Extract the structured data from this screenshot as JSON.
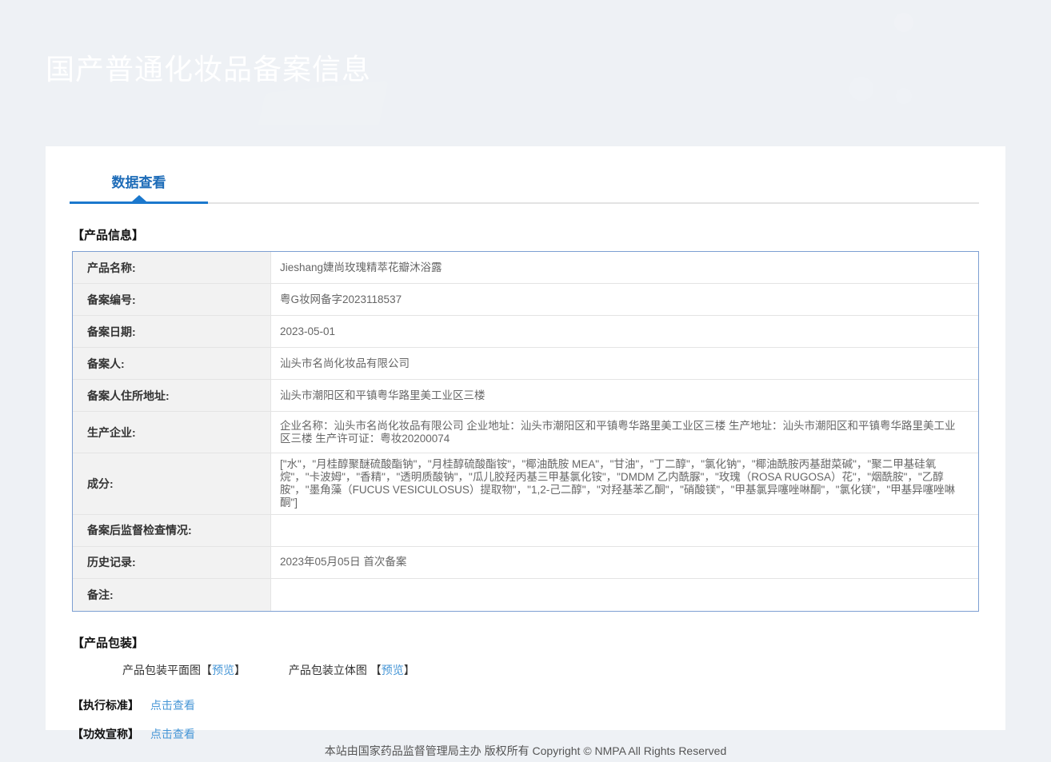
{
  "header": {
    "title": "国产普通化妆品备案信息"
  },
  "tabs": {
    "active": "数据查看"
  },
  "product_info": {
    "section_title": "【产品信息】",
    "rows": [
      {
        "label": "产品名称:",
        "value": "Jieshang婕尚玫瑰精萃花瓣沐浴露"
      },
      {
        "label": "备案编号:",
        "value": "粤G妆网备字2023118537"
      },
      {
        "label": "备案日期:",
        "value": "2023-05-01"
      },
      {
        "label": "备案人:",
        "value": "汕头市名尚化妆品有限公司"
      },
      {
        "label": "备案人住所地址:",
        "value": "汕头市潮阳区和平镇粤华路里美工业区三楼"
      },
      {
        "label": "生产企业:",
        "value": "企业名称：汕头市名尚化妆品有限公司 企业地址：汕头市潮阳区和平镇粤华路里美工业区三楼 生产地址：汕头市潮阳区和平镇粤华路里美工业区三楼 生产许可证：粤妆20200074"
      },
      {
        "label": "成分:",
        "value": "[\"水\"，\"月桂醇聚醚硫酸酯钠\"，\"月桂醇硫酸酯铵\"，\"椰油酰胺 MEA\"，\"甘油\"，\"丁二醇\"，\"氯化钠\"，\"椰油酰胺丙基甜菜碱\"，\"聚二甲基硅氧烷\"，\"卡波姆\"，\"香精\"，\"透明质酸钠\"，\"瓜儿胶羟丙基三甲基氯化铵\"，\"DMDM 乙内酰脲\"，\"玫瑰（ROSA RUGOSA）花\"，\"烟酰胺\"，\"乙醇胺\"，\"墨角藻（FUCUS VESICULOSUS）提取物\"，\"1,2-己二醇\"，\"对羟基苯乙酮\"，\"硝酸镁\"，\"甲基氯异噻唑啉酮\"，\"氯化镁\"，\"甲基异噻唑啉酮\"]"
      },
      {
        "label": "备案后监督检查情况:",
        "value": ""
      },
      {
        "label": "历史记录:",
        "value": "2023年05月05日 首次备案"
      },
      {
        "label": "备注:",
        "value": ""
      }
    ]
  },
  "packaging": {
    "section_title": "【产品包装】",
    "bracket_open": "【",
    "bracket_close": "】",
    "items": [
      {
        "label": "产品包装平面图",
        "link_text": "预览"
      },
      {
        "label": "产品包装立体图 ",
        "link_text": "预览"
      }
    ]
  },
  "standard": {
    "title": "【执行标准】",
    "link_text": "点击查看"
  },
  "efficacy": {
    "title": "【功效宣称】",
    "link_text": "点击查看"
  },
  "footer": {
    "text": "本站由国家药品监督管理局主办 版权所有 Copyright © NMPA All Rights Reserved"
  },
  "colors": {
    "header_gradient_top": "#1c4c9d",
    "header_gradient_bottom": "#2d7fd4",
    "accent_blue": "#1b78cd",
    "tab_text_blue": "#1e6cb8",
    "link_blue": "#4696d6",
    "table_border_blue": "#7d9fd2",
    "label_cell_bg": "#f2f2f2",
    "page_bg": "#eef1f5"
  }
}
